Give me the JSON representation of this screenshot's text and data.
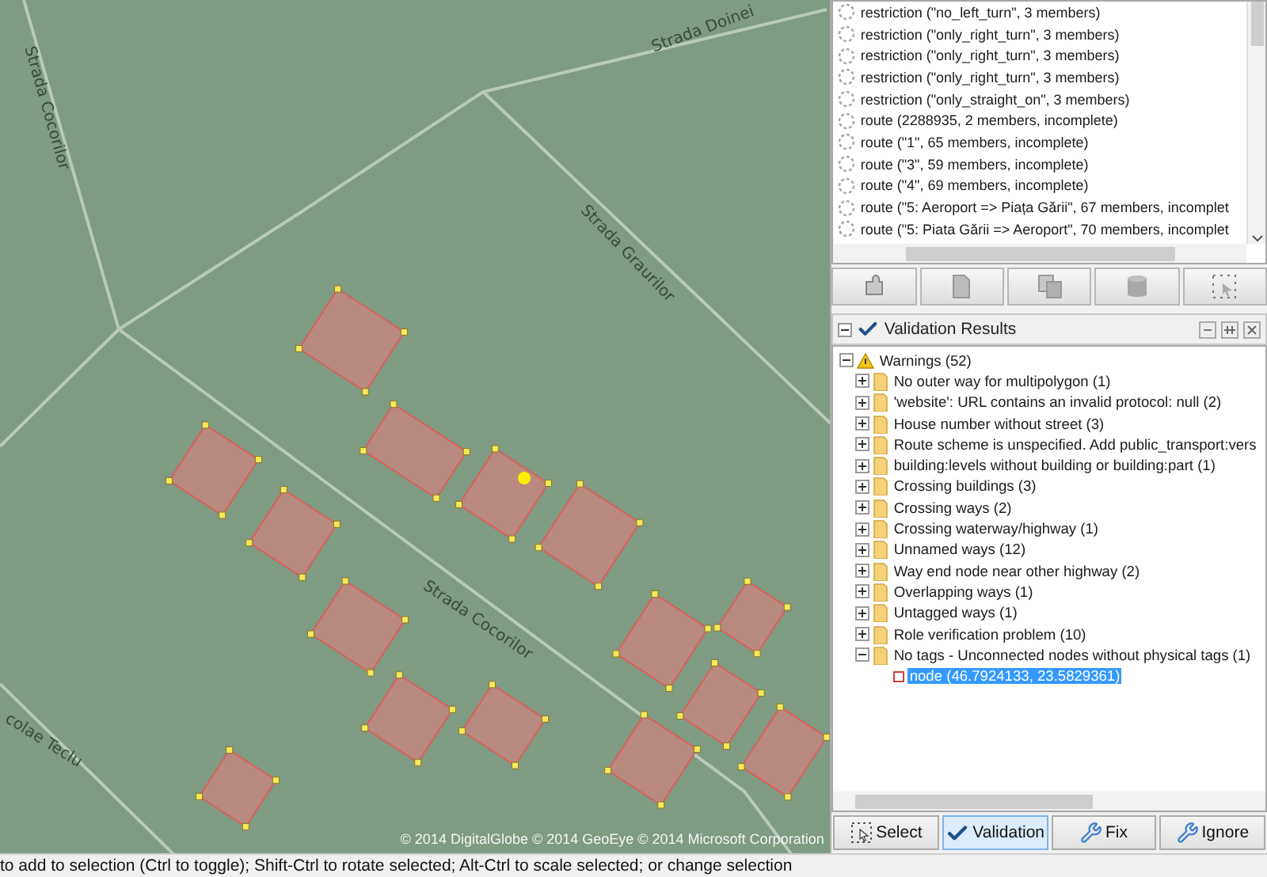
{
  "map": {
    "street_labels": [
      {
        "text": "Strada Doinei"
      },
      {
        "text": "Strada Cocorilor"
      },
      {
        "text": "Strada Graurilor"
      },
      {
        "text": "Strada Cocorilor"
      },
      {
        "text": "colae Teclu"
      }
    ],
    "attribution": "© 2014 DigitalGlobe © 2014 GeoEye © 2014 Microsoft Corporation"
  },
  "relations": {
    "items": [
      {
        "label": "restriction (\"no_left_turn\", 3 members)"
      },
      {
        "label": "restriction (\"only_right_turn\", 3 members)"
      },
      {
        "label": "restriction (\"only_right_turn\", 3 members)"
      },
      {
        "label": "restriction (\"only_right_turn\", 3 members)"
      },
      {
        "label": "restriction (\"only_straight_on\", 3 members)"
      },
      {
        "label": "route (2288935, 2 members, incomplete)"
      },
      {
        "label": "route (\"1\", 65 members, incomplete)"
      },
      {
        "label": "route (\"3\", 59 members, incomplete)"
      },
      {
        "label": "route (\"4\", 69 members, incomplete)"
      },
      {
        "label": "route (\"5: Aeroport => Piața Gării\", 67 members, incomplet"
      },
      {
        "label": "route (\"5: Piata Gării => Aeroport\", 70 members, incomplet"
      }
    ]
  },
  "validation": {
    "title": "Validation Results",
    "expanded": true,
    "root": {
      "label": "Warnings (52)",
      "expanded": true,
      "children": [
        {
          "label": "No outer way for multipolygon (1)",
          "expanded": false
        },
        {
          "label": "'website': URL contains an invalid protocol: null (2)",
          "expanded": false
        },
        {
          "label": "House number without street (3)",
          "expanded": false
        },
        {
          "label": "Route scheme is unspecified. Add public_transport:vers",
          "expanded": false
        },
        {
          "label": "building:levels without building or building:part (1)",
          "expanded": false
        },
        {
          "label": "Crossing buildings (3)",
          "expanded": false
        },
        {
          "label": "Crossing ways (2)",
          "expanded": false
        },
        {
          "label": "Crossing waterway/highway (1)",
          "expanded": false
        },
        {
          "label": "Unnamed ways (12)",
          "expanded": false
        },
        {
          "label": "Way end node near other highway (2)",
          "expanded": false
        },
        {
          "label": "Overlapping ways (1)",
          "expanded": false
        },
        {
          "label": "Untagged ways (1)",
          "expanded": false
        },
        {
          "label": "Role verification problem (10)",
          "expanded": false
        },
        {
          "label": "No tags - Unconnected nodes without physical tags (1)",
          "expanded": true,
          "children": [
            {
              "label": "node (46.7924133, 23.5829361)",
              "selected": true
            }
          ]
        }
      ]
    }
  },
  "buttons": [
    {
      "kind": "select",
      "label": "Select",
      "selected": false
    },
    {
      "kind": "validation",
      "label": "Validation",
      "selected": true
    },
    {
      "kind": "fix",
      "label": "Fix",
      "selected": false
    },
    {
      "kind": "ignore",
      "label": "Ignore",
      "selected": false
    }
  ],
  "status_bar": "to add to selection (Ctrl to toggle); Shift-Ctrl to rotate selected; Alt-Ctrl to scale selected; or change selection"
}
